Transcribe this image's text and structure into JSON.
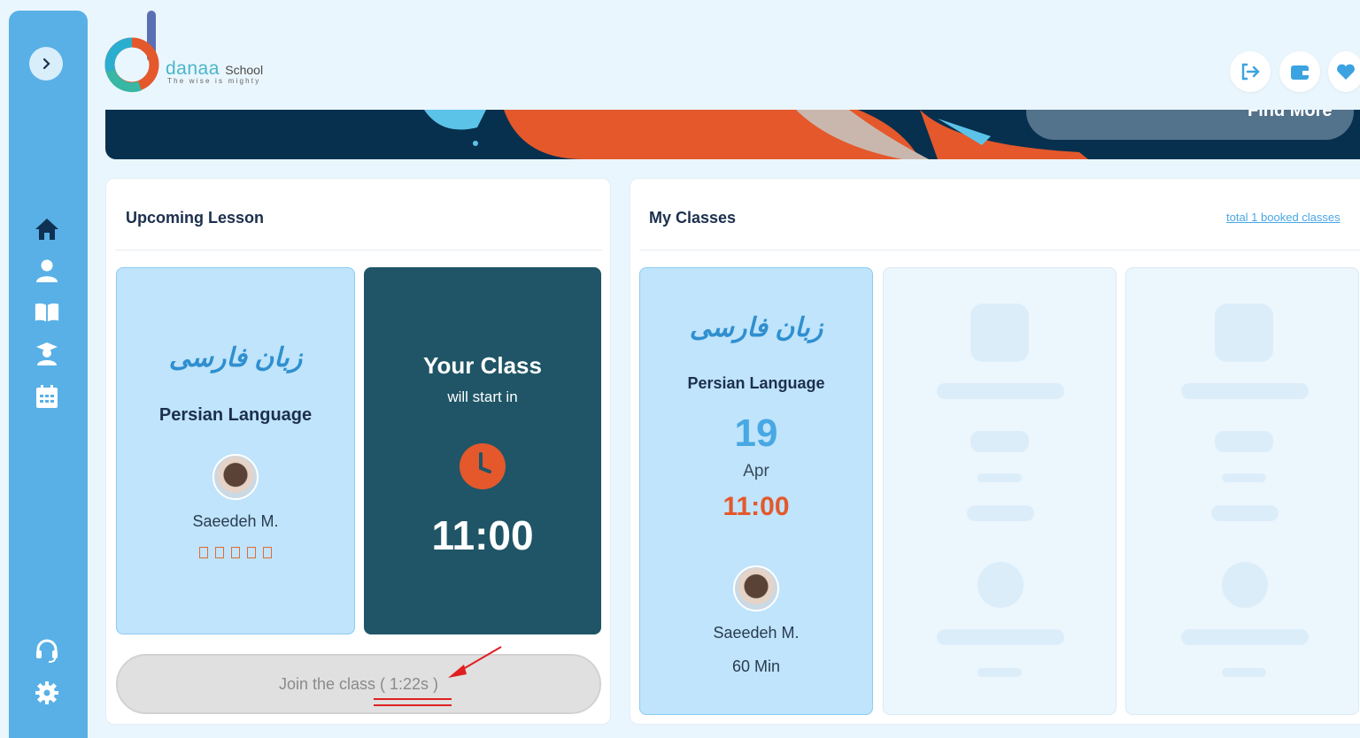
{
  "brand": {
    "name": "danaa",
    "school": "School",
    "tagline": "The wise is mighty"
  },
  "banner": {
    "button_label": "Find More"
  },
  "upcoming": {
    "title": "Upcoming Lesson",
    "course_logo_text": "زبان فارسی",
    "course": "Persian Language",
    "teacher": "Saeedeh M.",
    "countdown": {
      "heading": "Your Class",
      "subheading": "will start in",
      "time": "11:00"
    },
    "join_label": "Join the class ( 1:22s )"
  },
  "classes": {
    "title": "My Classes",
    "total_link": "total 1 booked classes",
    "items": [
      {
        "logo_text": "زبان فارسی",
        "course": "Persian Language",
        "day": "19",
        "month": "Apr",
        "time": "11:00",
        "teacher": "Saeedeh M.",
        "duration": "60 Min"
      }
    ]
  },
  "colors": {
    "sidebar": "#58b0e6",
    "accent_orange": "#e4582b",
    "teal_dark": "#1f5566",
    "card_blue": "#bfe4fb"
  },
  "icons": {
    "sidebar": [
      "chevron-right-icon",
      "home-icon",
      "user-icon",
      "book-icon",
      "graduate-icon",
      "calendar-icon",
      "headset-icon",
      "gear-icon"
    ],
    "header": [
      "logout-icon",
      "wallet-icon",
      "heart-icon"
    ]
  }
}
